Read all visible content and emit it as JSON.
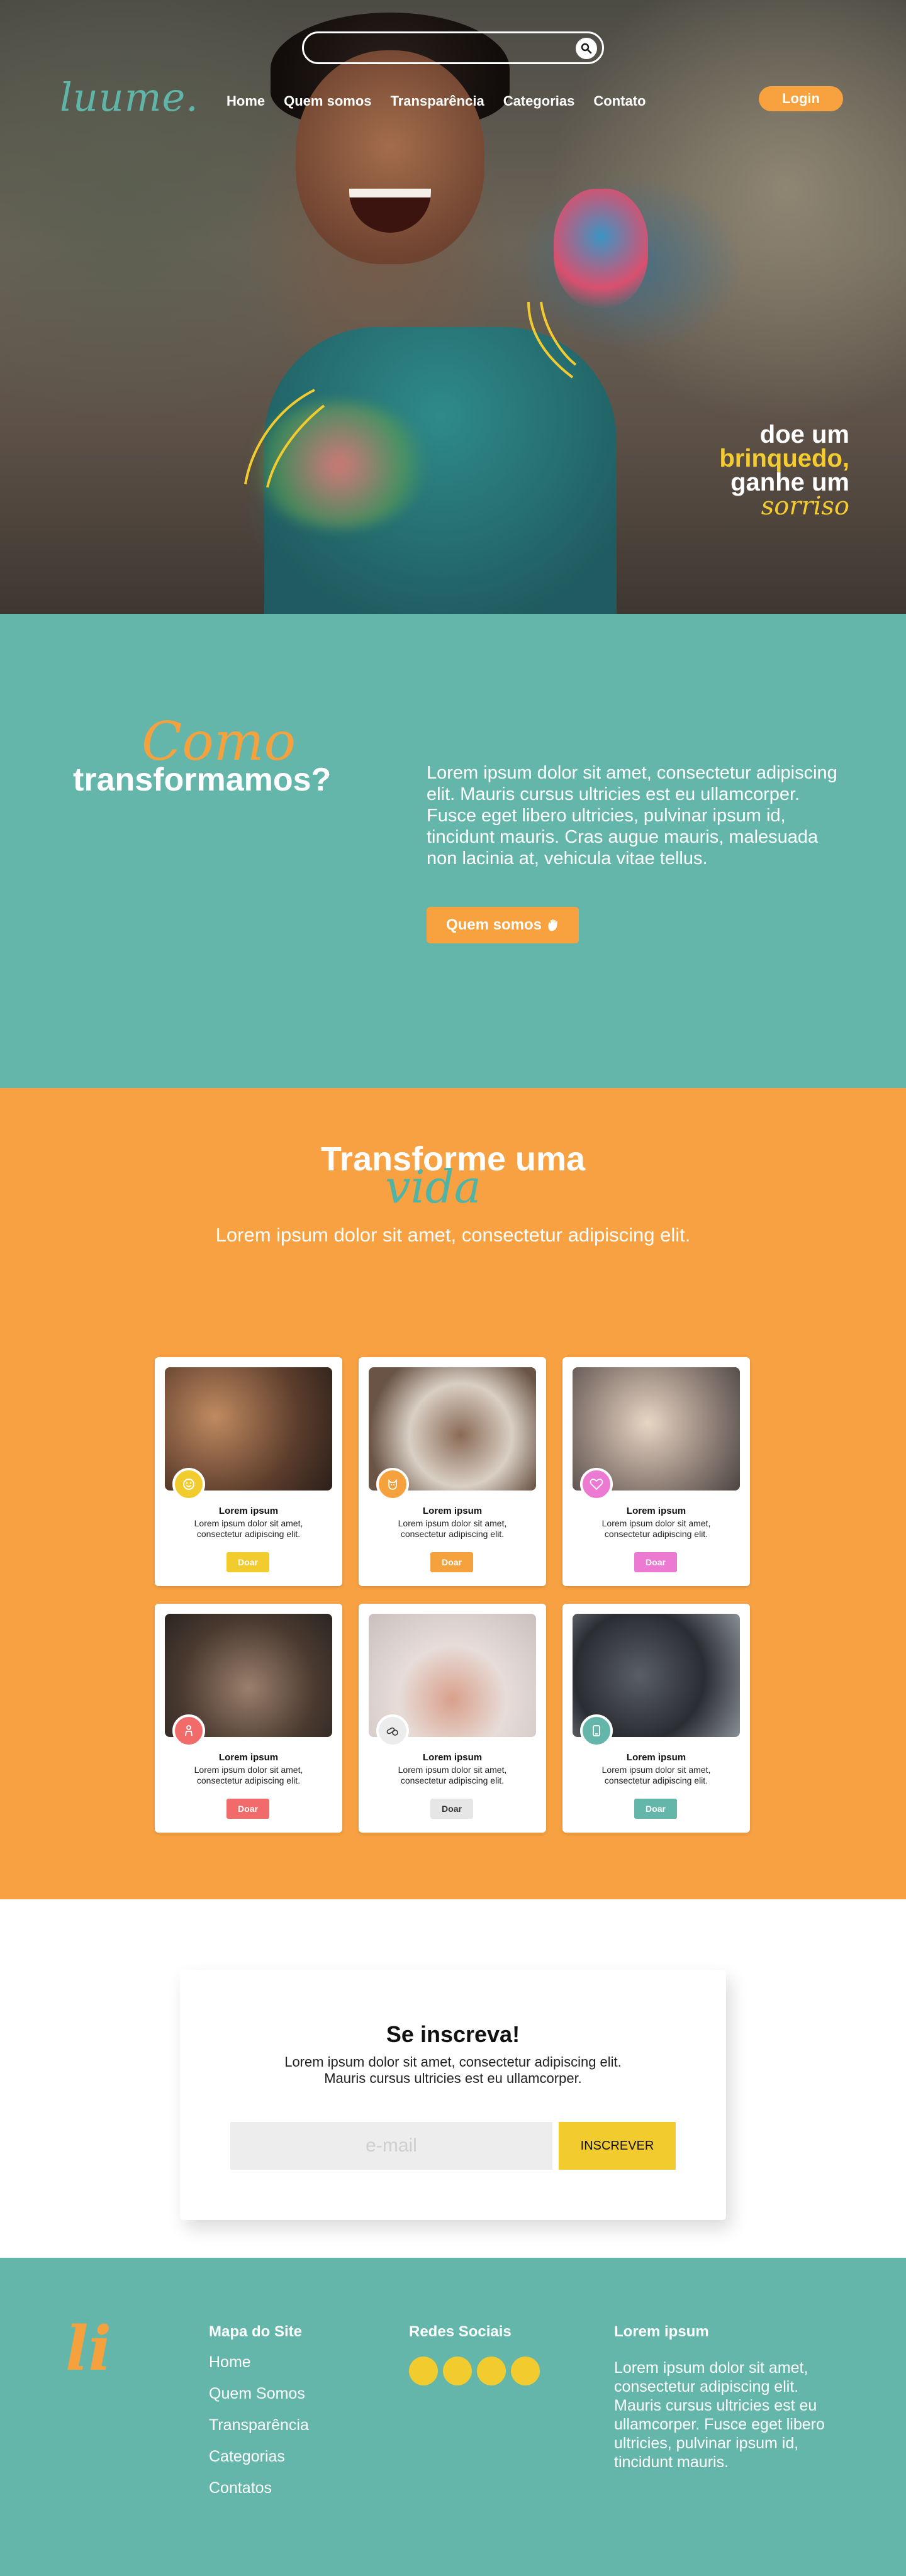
{
  "header": {
    "search_placeholder": "",
    "logo": "luume.",
    "nav": [
      "Home",
      "Quem somos",
      "Transparência",
      "Categorias",
      "Contato"
    ],
    "login_label": "Login"
  },
  "hero": {
    "tagline_line1": "doe um",
    "tagline_line2": "brinquedo,",
    "tagline_line3": "ganhe um",
    "tagline_script": "sorriso"
  },
  "about": {
    "script_word": "Como",
    "heading": "transformamos?",
    "text": "Lorem ipsum dolor sit amet, consectetur adipiscing elit. Mauris cursus ultricies est eu ullamcorper. Fusce eget libero ultricies, pulvinar ipsum id, tincidunt mauris. Cras augue mauris, malesuada non lacinia at, vehicula vitae tellus.",
    "button_label": "Quem somos"
  },
  "donate": {
    "heading": "Transforme uma",
    "script_word": "vida",
    "subtitle": "Lorem ipsum dolor sit amet, consectetur adipiscing elit.",
    "cards": [
      {
        "title": "Lorem ipsum",
        "text": "Lorem ipsum dolor sit amet, consectetur adipiscing elit.",
        "button": "Doar",
        "color": "#f2cb2e",
        "icon": "children-icon"
      },
      {
        "title": "Lorem ipsum",
        "text": "Lorem ipsum dolor sit amet, consectetur adipiscing elit.",
        "button": "Doar",
        "color": "#f5a13d",
        "icon": "dog-icon"
      },
      {
        "title": "Lorem ipsum",
        "text": "Lorem ipsum dolor sit amet, consectetur adipiscing elit.",
        "button": "Doar",
        "color": "#ec7ad2",
        "icon": "heart-icon"
      },
      {
        "title": "Lorem ipsum",
        "text": "Lorem ipsum dolor sit amet, consectetur adipiscing elit.",
        "button": "Doar",
        "color": "#f26b6b",
        "icon": "elderly-icon"
      },
      {
        "title": "Lorem ipsum",
        "text": "Lorem ipsum dolor sit amet, consectetur adipiscing elit.",
        "button": "Doar",
        "color": "#e6e6e6",
        "icon": "pills-icon"
      },
      {
        "title": "Lorem ipsum",
        "text": "Lorem ipsum dolor sit amet, consectetur adipiscing elit.",
        "button": "Doar",
        "color": "#64b6aa",
        "icon": "recycle-icon"
      }
    ]
  },
  "subscribe": {
    "title": "Se inscreva!",
    "text": "Lorem ipsum dolor sit amet, consectetur adipiscing elit. Mauris cursus ultricies est eu ullamcorper.",
    "email_placeholder": "e-mail",
    "button_label": "INSCREVER"
  },
  "footer": {
    "logo": "li",
    "sitemap_title": "Mapa do Site",
    "sitemap": [
      "Home",
      "Quem Somos",
      "Transparência",
      "Categorias",
      "Contatos"
    ],
    "social_title": "Redes Sociais",
    "about_title": "Lorem ipsum",
    "about_text": "Lorem ipsum dolor sit amet, consectetur adipiscing elit. Mauris cursus ultricies est eu ullamcorper. Fusce eget libero ultricies, pulvinar ipsum id, tincidunt mauris."
  },
  "colors": {
    "teal": "#64b6aa",
    "orange": "#f8a142",
    "yellow": "#f2cb2e"
  }
}
